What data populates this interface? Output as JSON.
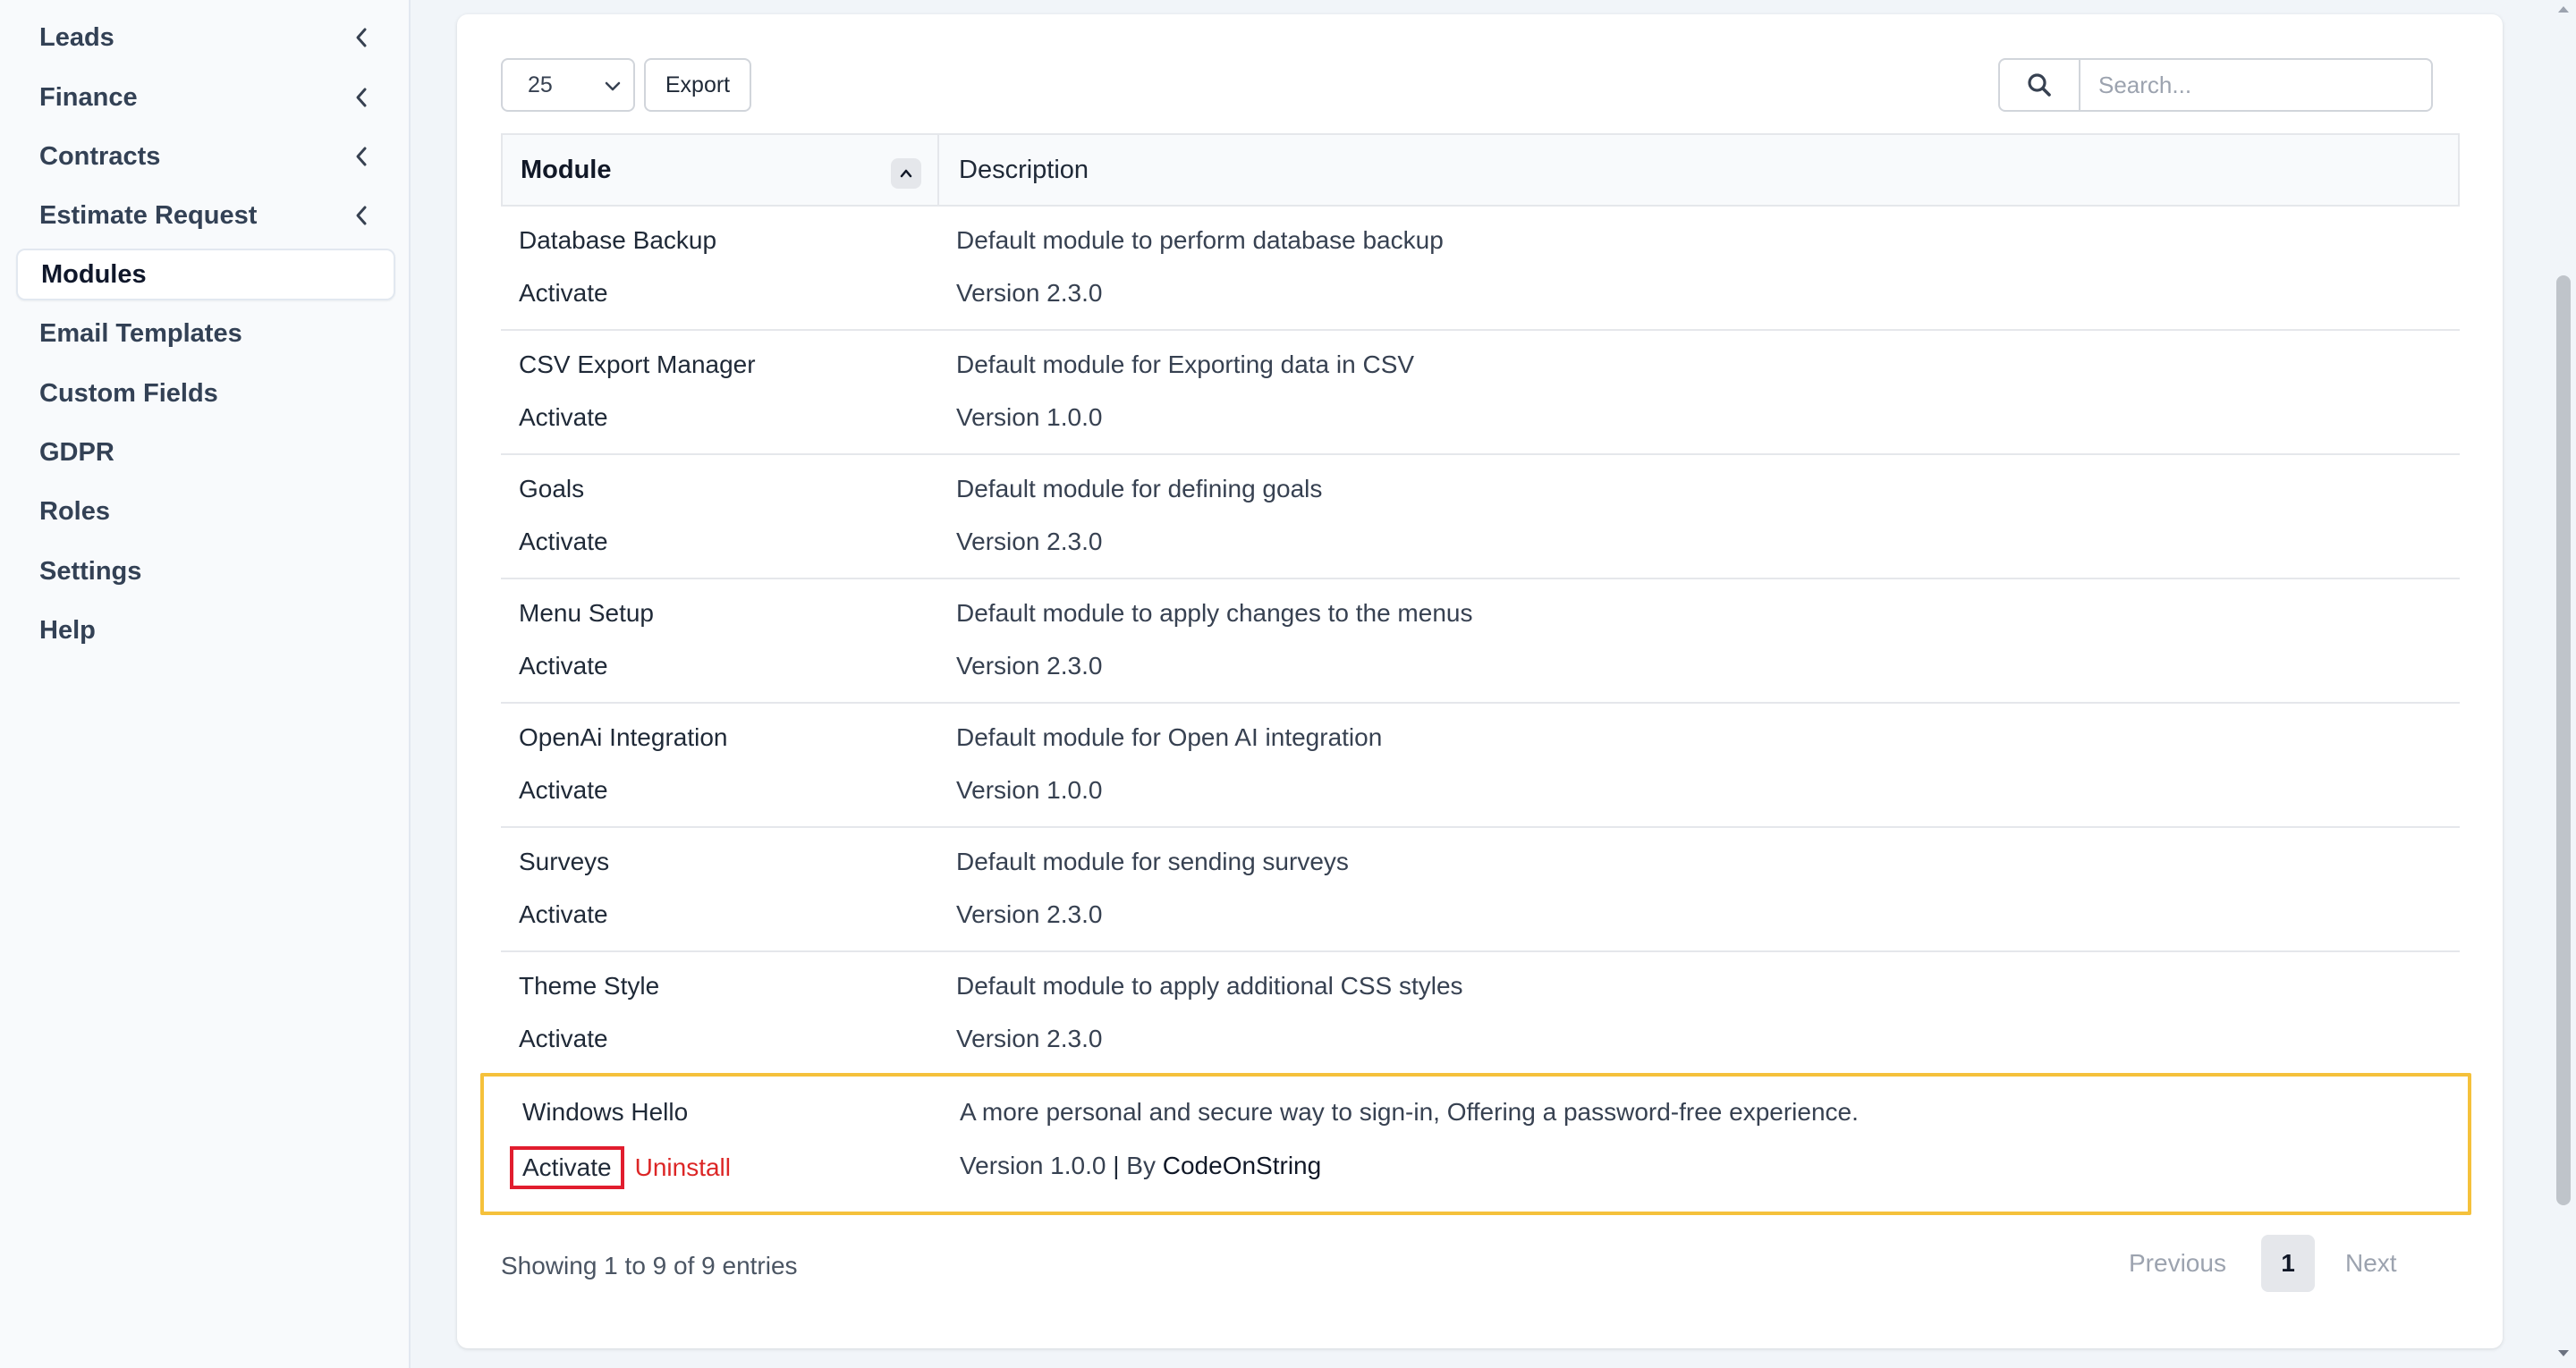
{
  "sidebar": {
    "items": [
      {
        "label": "Leads",
        "has_chevron": true
      },
      {
        "label": "Finance",
        "has_chevron": true
      },
      {
        "label": "Contracts",
        "has_chevron": true
      },
      {
        "label": "Estimate Request",
        "has_chevron": true
      },
      {
        "label": "Modules",
        "active": true
      },
      {
        "label": "Email Templates"
      },
      {
        "label": "Custom Fields"
      },
      {
        "label": "GDPR"
      },
      {
        "label": "Roles"
      },
      {
        "label": "Settings"
      },
      {
        "label": "Help"
      }
    ]
  },
  "toolbar": {
    "page_length": "25",
    "export_label": "Export",
    "search_placeholder": "Search..."
  },
  "table": {
    "columns": [
      "Module",
      "Description"
    ],
    "rows": [
      {
        "name": "Database Backup",
        "action": "Activate",
        "description": "Default module to perform database backup",
        "version": "Version 2.3.0"
      },
      {
        "name": "CSV Export Manager",
        "action": "Activate",
        "description": "Default module for Exporting data in CSV",
        "version": "Version 1.0.0"
      },
      {
        "name": "Goals",
        "action": "Activate",
        "description": "Default module for defining goals",
        "version": "Version 2.3.0"
      },
      {
        "name": "Menu Setup",
        "action": "Activate",
        "description": "Default module to apply changes to the menus",
        "version": "Version 2.3.0"
      },
      {
        "name": "OpenAi Integration",
        "action": "Activate",
        "description": "Default module for Open AI integration",
        "version": "Version 1.0.0"
      },
      {
        "name": "Surveys",
        "action": "Activate",
        "description": "Default module for sending surveys",
        "version": "Version 2.3.0"
      },
      {
        "name": "Theme Style",
        "action": "Activate",
        "description": "Default module to apply additional CSS styles",
        "version": "Version 2.3.0"
      }
    ],
    "highlighted_row": {
      "name": "Windows Hello",
      "action": "Activate",
      "uninstall": "Uninstall",
      "description": "A more personal and secure way to sign-in, Offering a password-free experience.",
      "version": "Version 1.0.0",
      "separator": "|",
      "by_prefix": "By",
      "author": "CodeOnString"
    }
  },
  "footer": {
    "info": "Showing 1 to 9 of 9 entries",
    "prev": "Previous",
    "page": "1",
    "next": "Next"
  },
  "colors": {
    "highlight_border": "#f5c13b",
    "activate_box": "#e11d2e",
    "uninstall": "#dc2626"
  }
}
